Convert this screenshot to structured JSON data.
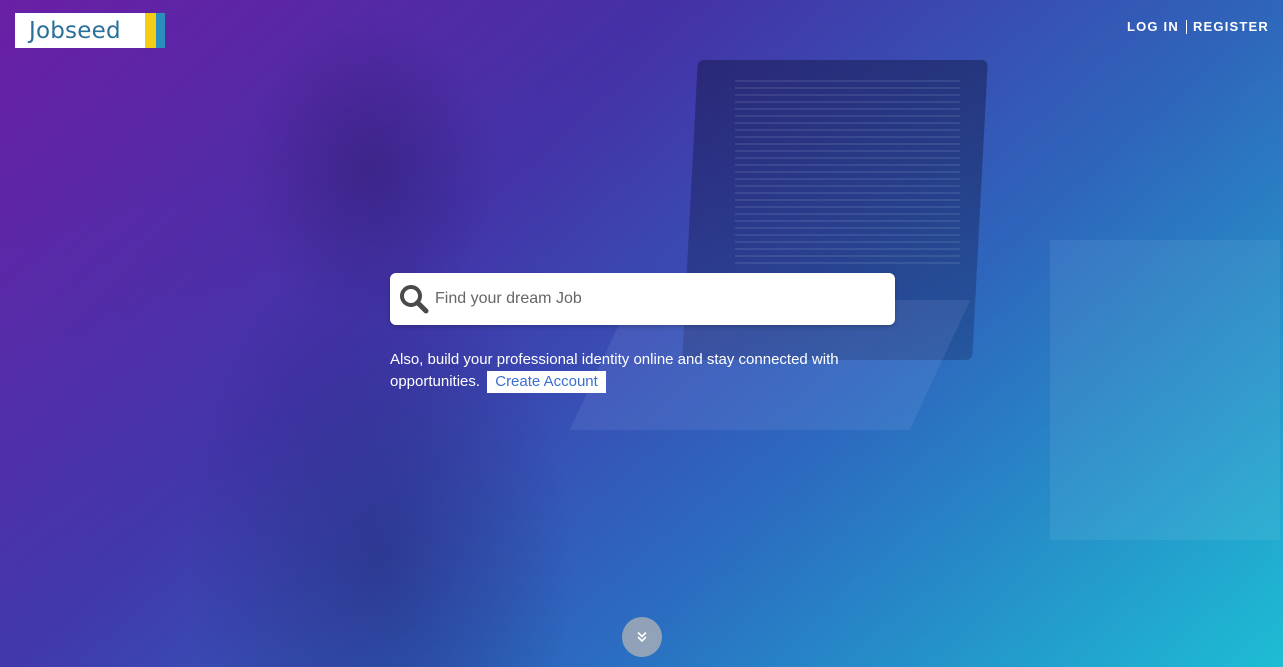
{
  "header": {
    "logo_text": "Jobseed",
    "nav": {
      "login_label": "LOG IN",
      "register_label": "REGISTER"
    }
  },
  "search": {
    "placeholder": "Find your dream Job",
    "icon": "search-icon"
  },
  "tagline": {
    "text": "Also, build your professional identity online and stay connected with opportunities.",
    "cta_label": "Create Account"
  },
  "scroll": {
    "icon": "double-chevron-down-icon"
  },
  "colors": {
    "gradient_start": "#6e1eaa",
    "gradient_mid": "#2d6ec8",
    "gradient_end": "#1ec8dc",
    "logo_text": "#2a6f9a",
    "logo_yellow": "#f4cc16",
    "logo_blue": "#2b8fbe",
    "cta_text": "#3b6ed3"
  }
}
